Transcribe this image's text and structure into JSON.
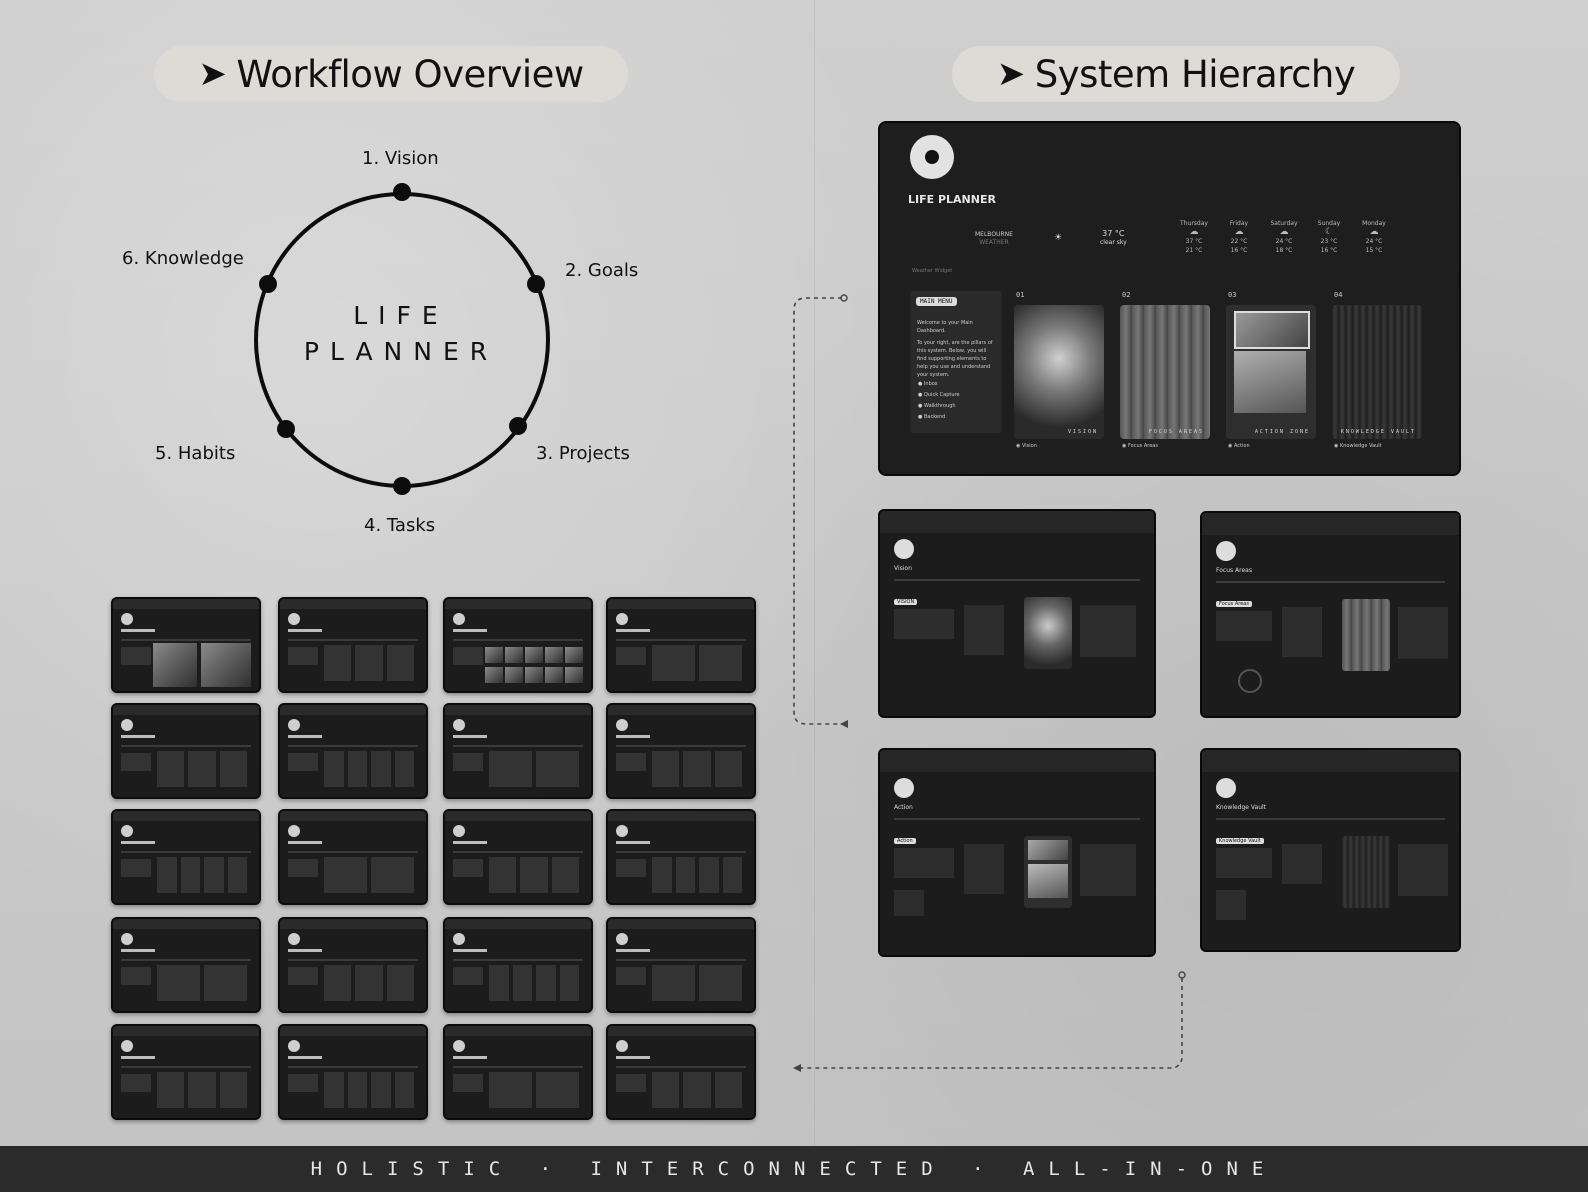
{
  "headings": {
    "workflow": "Workflow Overview",
    "hierarchy": "System Hierarchy",
    "arrow": "➤"
  },
  "cycle": {
    "center_line1": "LIFE",
    "center_line2": "PLANNER",
    "stages": [
      "1. Vision",
      "2. Goals",
      "3. Projects",
      "4. Tasks",
      "5. Habits",
      "6. Knowledge"
    ]
  },
  "dashboard": {
    "title": "LIFE PLANNER",
    "weather": {
      "city": "MELBOURNE",
      "city_sub": "WEATHER",
      "icon": "☀",
      "temp": "37 °C",
      "desc": "clear sky",
      "widget_label": "Weather Widget",
      "forecast": [
        {
          "day": "Thursday",
          "hi": "37 °C",
          "lo": "21 °C"
        },
        {
          "day": "Friday",
          "hi": "22 °C",
          "lo": "16 °C"
        },
        {
          "day": "Saturday",
          "hi": "24 °C",
          "lo": "18 °C"
        },
        {
          "day": "Sunday",
          "hi": "23 °C",
          "lo": "16 °C"
        },
        {
          "day": "Monday",
          "hi": "24 °C",
          "lo": "15 °C"
        }
      ]
    },
    "menu": {
      "tag": "MAIN MENU",
      "text1": "Welcome to your Main Dashboard.",
      "text2": "To your right, are the pillars of this system. Below, you will find supporting elements to help you use and understand your system.",
      "items": [
        "Inbox",
        "Quick Capture",
        "Walkthrough",
        "Backend"
      ]
    },
    "cards": [
      {
        "num": "01",
        "cap": "VISION",
        "link": "Vision"
      },
      {
        "num": "02",
        "cap": "FOCUS AREAS",
        "link": "Focus Areas"
      },
      {
        "num": "03",
        "cap": "ACTION ZONE",
        "link": "Action"
      },
      {
        "num": "04",
        "cap": "KNOWLEDGE VAULT",
        "link": "Knowledge Vault"
      }
    ]
  },
  "subpages": [
    {
      "title": "Vision",
      "tag": "VISION"
    },
    {
      "title": "Focus Areas",
      "tag": "Focus Areas"
    },
    {
      "title": "Action",
      "tag": "Action"
    },
    {
      "title": "Knowledge Vault",
      "tag": "Knowledge Vault"
    }
  ],
  "footer": "HOLISTIC · INTERCONNECTED · ALL-IN-ONE"
}
